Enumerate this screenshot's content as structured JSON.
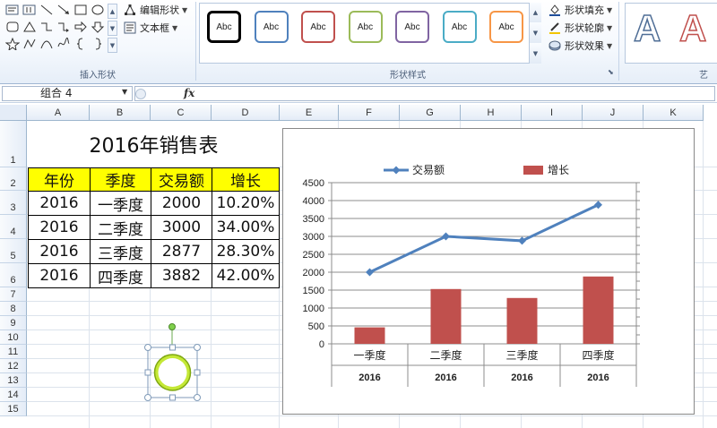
{
  "ribbon": {
    "insert_shapes": {
      "group_label": "插入形状",
      "edit_shape_label": "编辑形状",
      "text_box_label": "文本框",
      "shapes": [
        "text-box-icon",
        "vertical-text-box-icon",
        "line-icon",
        "arrow-icon",
        "rectangle-icon",
        "oval-icon",
        "rounded-rectangle-icon",
        "triangle-icon",
        "elbow-connector-icon",
        "elbow-arrow-connector-icon",
        "block-arrow-right-icon",
        "block-arrow-down-icon",
        "star-icon",
        "freeform-icon",
        "curve-icon",
        "scribble-icon",
        "left-brace-icon",
        "right-brace-icon"
      ]
    },
    "shape_styles": {
      "group_label": "形状样式",
      "swatch_label": "Abc",
      "swatch_colors": [
        "#000000",
        "#4f81bd",
        "#c0504d",
        "#9bbb59",
        "#8064a2",
        "#4bacc6",
        "#f79646"
      ],
      "fill_label": "形状填充",
      "outline_label": "形状轮廓",
      "effects_label": "形状效果"
    },
    "wordart": {
      "group_label": "艺",
      "samples": [
        "A",
        "A"
      ]
    }
  },
  "formula_bar": {
    "name_box_value": "组合 4",
    "fx_label": "fx",
    "formula_value": ""
  },
  "sheet": {
    "columns": [
      "A",
      "B",
      "C",
      "D",
      "E",
      "F",
      "G",
      "H",
      "I",
      "J",
      "K"
    ],
    "rows": [
      "1",
      "2",
      "3",
      "4",
      "5",
      "6",
      "7",
      "8",
      "9",
      "10",
      "11",
      "12",
      "13",
      "14",
      "15"
    ],
    "title": "2016年销售表",
    "table_headers": [
      "年份",
      "季度",
      "交易额",
      "增长"
    ],
    "table_rows": [
      [
        "2016",
        "一季度",
        "2000",
        "10.20%"
      ],
      [
        "2016",
        "二季度",
        "3000",
        "34.00%"
      ],
      [
        "2016",
        "三季度",
        "2877",
        "28.30%"
      ],
      [
        "2016",
        "四季度",
        "3882",
        "42.00%"
      ]
    ],
    "header_fill": "#ffff00"
  },
  "chart_data": {
    "type": "bar",
    "categories": [
      "一季度",
      "二季度",
      "三季度",
      "四季度"
    ],
    "category_group_labels": [
      "2016",
      "2016",
      "2016",
      "2016"
    ],
    "series": [
      {
        "name": "交易额",
        "type": "line",
        "values": [
          2000,
          3000,
          2877,
          3882
        ],
        "color": "#4f81bd"
      },
      {
        "name": "增长",
        "type": "bar",
        "values": [
          460,
          1530,
          1280,
          1880
        ],
        "color": "#c0504d"
      }
    ],
    "y_ticks": [
      "0",
      "500",
      "1000",
      "1500",
      "2000",
      "2500",
      "3000",
      "3500",
      "4000",
      "4500"
    ],
    "ylim": [
      0,
      4500
    ],
    "grid": true,
    "legend_position": "top"
  }
}
